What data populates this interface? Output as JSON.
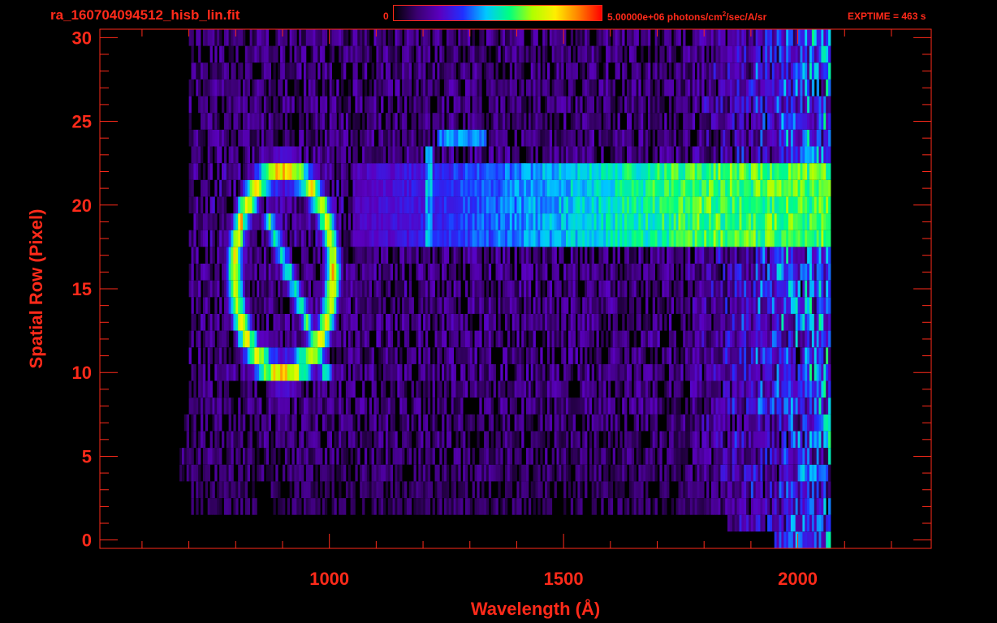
{
  "header": {
    "filename": "ra_160704094512_hisb_lin.fit",
    "colorbar_min": "0",
    "colorbar_max_prefix": "5.00000e+06 photons/cm",
    "colorbar_max_sup": "2",
    "colorbar_max_suffix": "/sec/A/sr",
    "exptime": "EXPTIME = 463 s"
  },
  "colors": {
    "axis": "#ff2a1a",
    "background": "#000000",
    "colormap": [
      "#000000",
      "#3a0070",
      "#5a00c0",
      "#2030ff",
      "#00c8ff",
      "#00ff80",
      "#b0ff00",
      "#ffee00",
      "#ff8000",
      "#ff0000"
    ]
  },
  "chart_data": {
    "type": "heatmap",
    "title": "",
    "xlabel": "Wavelength (Å)",
    "ylabel": "Spatial Row (Pixel)",
    "xlim": [
      510,
      2285
    ],
    "ylim": [
      -0.5,
      30.5
    ],
    "xticks": [
      1000,
      1500,
      2000
    ],
    "yticks": [
      0,
      5,
      10,
      15,
      20,
      25,
      30
    ],
    "colorbar_range": [
      0,
      5000000
    ],
    "colorbar_units": "photons/cm^2/sec/A/sr",
    "detector_range": [
      680,
      2070
    ],
    "features": [
      {
        "kind": "ring",
        "center_x": 900,
        "center_row": 16,
        "radius_x": 105,
        "radius_row": 6,
        "peak": 0.72
      },
      {
        "kind": "diagonal streak",
        "start": [
          990,
          10
        ],
        "end": [
          870,
          19
        ],
        "peak": 0.5
      },
      {
        "kind": "continuum band",
        "x_range": [
          1050,
          2070
        ],
        "rows": [
          18,
          19,
          20,
          21,
          22
        ],
        "peak": 0.62
      },
      {
        "kind": "emission spot",
        "x_range": [
          1230,
          1330
        ],
        "row": 24,
        "peak": 0.42
      },
      {
        "kind": "vertical line",
        "x": 1210,
        "rows": [
          18,
          23
        ],
        "peak": 0.45
      }
    ],
    "rows": [
      {
        "row": 0,
        "x_range": [
          1950,
          2070
        ],
        "level": 0.15
      },
      {
        "row": 1,
        "x_range": [
          1850,
          2070
        ],
        "level": 0.15
      },
      {
        "row": 2,
        "x_range": [
          700,
          2070
        ],
        "level": 0.12
      },
      {
        "row": 3,
        "x_range": [
          700,
          2070
        ],
        "level": 0.12
      },
      {
        "row": 4,
        "x_range": [
          680,
          2070
        ],
        "level": 0.14
      },
      {
        "row": 5,
        "x_range": [
          680,
          2070
        ],
        "level": 0.15
      },
      {
        "row": 6,
        "x_range": [
          690,
          2070
        ],
        "level": 0.16
      },
      {
        "row": 7,
        "x_range": [
          690,
          2070
        ],
        "level": 0.16
      },
      {
        "row": 8,
        "x_range": [
          700,
          2070
        ],
        "level": 0.17
      },
      {
        "row": 9,
        "x_range": [
          700,
          2070
        ],
        "level": 0.17
      },
      {
        "row": 10,
        "x_range": [
          700,
          2070
        ],
        "level": 0.18
      },
      {
        "row": 11,
        "x_range": [
          700,
          2070
        ],
        "level": 0.18
      },
      {
        "row": 12,
        "x_range": [
          700,
          2070
        ],
        "level": 0.18
      },
      {
        "row": 13,
        "x_range": [
          700,
          2070
        ],
        "level": 0.18
      },
      {
        "row": 14,
        "x_range": [
          700,
          2070
        ],
        "level": 0.18
      },
      {
        "row": 15,
        "x_range": [
          700,
          2070
        ],
        "level": 0.18
      },
      {
        "row": 16,
        "x_range": [
          700,
          2070
        ],
        "level": 0.18
      },
      {
        "row": 17,
        "x_range": [
          700,
          2070
        ],
        "level": 0.18
      },
      {
        "row": 18,
        "x_range": [
          700,
          2070
        ],
        "level": 0.2
      },
      {
        "row": 19,
        "x_range": [
          700,
          2070
        ],
        "level": 0.2
      },
      {
        "row": 20,
        "x_range": [
          700,
          2070
        ],
        "level": 0.2
      },
      {
        "row": 21,
        "x_range": [
          700,
          2070
        ],
        "level": 0.2
      },
      {
        "row": 22,
        "x_range": [
          700,
          2070
        ],
        "level": 0.2
      },
      {
        "row": 23,
        "x_range": [
          700,
          2070
        ],
        "level": 0.18
      },
      {
        "row": 24,
        "x_range": [
          700,
          2070
        ],
        "level": 0.17
      },
      {
        "row": 25,
        "x_range": [
          700,
          2070
        ],
        "level": 0.17
      },
      {
        "row": 26,
        "x_range": [
          700,
          2070
        ],
        "level": 0.17
      },
      {
        "row": 27,
        "x_range": [
          700,
          2070
        ],
        "level": 0.17
      },
      {
        "row": 28,
        "x_range": [
          700,
          2070
        ],
        "level": 0.17
      },
      {
        "row": 29,
        "x_range": [
          700,
          2070
        ],
        "level": 0.17
      },
      {
        "row": 30,
        "x_range": [
          700,
          2070
        ],
        "level": 0.17
      }
    ]
  }
}
